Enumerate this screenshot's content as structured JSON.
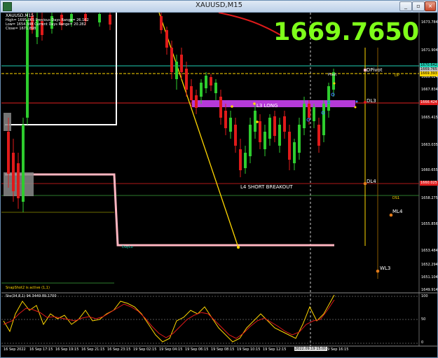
{
  "window": {
    "title": "XAUUSD,M15",
    "buttons": {
      "minimize": "_",
      "restore": "▫",
      "close": "×"
    }
  },
  "chart": {
    "symbol_line": "XAUUSD,M15",
    "info_lines": [
      "High= 1695.065     Previous Days Range= 26.162",
      "Low= 1654.348      Current Days Range= 20.282",
      "Close= 1671.898"
    ],
    "big_price": "1669.7650",
    "labels": {
      "l3_long": "L3 LONG",
      "l4_short": "L4 SHORT BREAKOUT",
      "dpivot": "DPivot",
      "dp": "DP",
      "pivot": "Pivot",
      "dl3": "DL3",
      "dl4": "DL4",
      "ds1": "DS1",
      "ml4": "ML4",
      "wl3": "WL3",
      "daylo": "DayLo",
      "snapshot": "SnapShot2 is active (1,1)",
      "stoch": "Sto(34,8,1) 94.3449 89.1700"
    },
    "price_axis": [
      "1673.784",
      "1671.904",
      "1669.024",
      "1667.834",
      "1665.415",
      "1663.035",
      "1660.655",
      "1658.275",
      "1655.856",
      "1653.484",
      "1652.294",
      "1651.104",
      "1649.914"
    ],
    "price_tags": [
      {
        "value": "1670.642",
        "color": "#1fd1b5"
      },
      {
        "value": "1669.765",
        "color": "#c0c0c0"
      },
      {
        "value": "1669.393",
        "color": "#ffd700"
      },
      {
        "value": "1666.424",
        "color": "#e02020"
      },
      {
        "value": "1660.025",
        "color": "#e02020"
      }
    ],
    "osc_axis": [
      "100",
      "50",
      "0"
    ],
    "time_axis": [
      "16 Sep 2022",
      "16 Sep 17:15",
      "16 Sep 19:15",
      "16 Sep 21:15",
      "16 Sep 23:15",
      "19 Sep 02:15",
      "19 Sep 04:15",
      "19 Sep 06:15",
      "19 Sep 08:15",
      "19 Sep 10:15",
      "19 Sep 12:15",
      "2022.09.19 15:00",
      "19 Sep 16:15"
    ]
  }
}
